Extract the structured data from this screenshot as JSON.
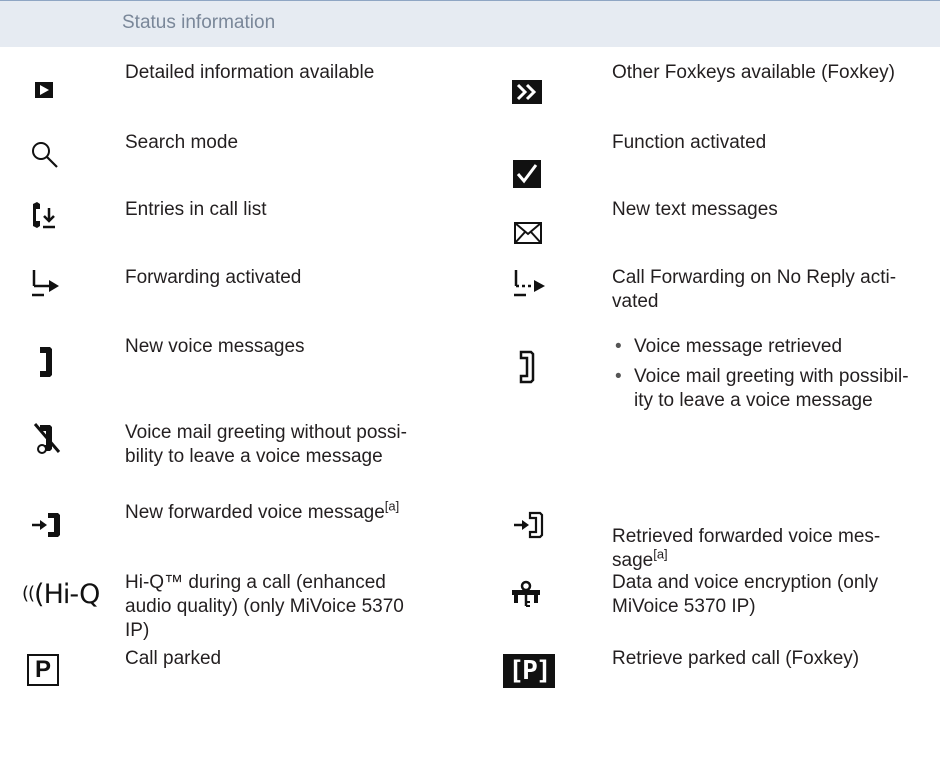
{
  "header": {
    "title": "Status information"
  },
  "left": {
    "detailed": "Detailed information available",
    "search": "Search mode",
    "calllist": "Entries in call list",
    "forwarding": "Forwarding activated",
    "voice_new": "New voice messages",
    "greeting_no_msg": "Voice mail greeting without possi-\nbility to leave a voice message",
    "forwarded_new": "New forwarded voice message",
    "forwarded_new_note": "[a]",
    "hiq": "Hi-Q™ during a call (enhanced audio quality) (only MiVoice 5370 IP)",
    "hiq_icon_text": "(Hi-Q",
    "parked": "Call parked",
    "parked_icon_text": "P"
  },
  "right": {
    "foxkeys": "Other Foxkeys available (Foxkey)",
    "activated": "Function activated",
    "text_msgs": "New text messages",
    "fwd_no_reply": "Call Forwarding on No Reply acti-\nvated",
    "voice_retrieved": "Voice message retrieved",
    "greeting_with_msg": "Voice mail greeting with possibil-\nity to leave a voice message",
    "forwarded_retrieved": "Retrieved forwarded voice mes-\nsage",
    "forwarded_retrieved_note": "[a]",
    "encryption": "Data and voice encryption (only MiVoice 5370 IP)",
    "retrieve_parked": "Retrieve parked call (Foxkey)",
    "retrieve_parked_icon_text": "[P]"
  }
}
